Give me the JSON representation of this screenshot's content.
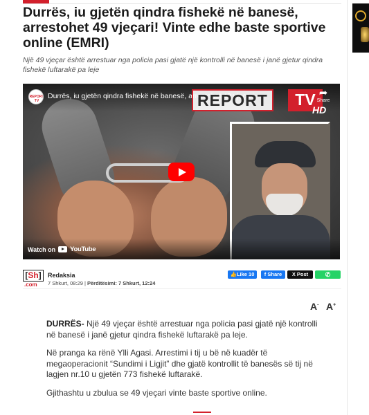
{
  "article": {
    "title": "Durrës, iu gjetën qindra fishekë në banesë, arrestohet 49 vjeçari! Vinte edhe baste sportive online (EMRI)",
    "lead": "Një 49 vjeçar është arrestuar nga policia pasi gjatë një kontrolli në banesë i janë gjetur qindra fishekë luftarakë pa leje",
    "location": "DURRËS-",
    "paragraph1_rest": " Një 49 vjeçar është arrestuar nga policia pasi gjatë një kontrolli në banesë i janë gjetur qindra fishekë luftarakë pa leje.",
    "paragraph2": "Në pranga ka rënë Ylli Agasi. Arrestimi i tij u bë në kuadër të megaoperacionit “Sundimi i Ligjit” dhe gjatë kontrollit të banesës së tij në lagjen nr.10 u gjetën 773 fishekë luftarakë.",
    "paragraph3": "Gjithashtu u zbulua se 49 vjeçari vinte baste sportive online."
  },
  "video": {
    "title": "Durrës, iu gjetën qindra fishekë në banesë, arrestohet 49 vjeçari",
    "channel_icon_text": "REPORT TV",
    "share_label": "Share",
    "logo_report": "REPORT",
    "logo_tv": "TV",
    "logo_hd": "HD",
    "watch_on": "Watch on",
    "youtube": "YouTube"
  },
  "meta": {
    "logo_sh": "Sh",
    "logo_com": ".com",
    "author": "Redaksia",
    "published": "7 Shkurt, 08:29 | ",
    "updated_label": "Përditësimi:",
    "updated": " 7 Shkurt, 12:24"
  },
  "share": {
    "fb_like": "Like 10",
    "fb_share": "Share",
    "x_post": "Post",
    "whatsapp": "✆"
  },
  "font_controls": {
    "decrease": "A",
    "decrease_sup": "-",
    "increase": "A",
    "increase_sup": "+"
  },
  "colors": {
    "brand_red": "#d3202c",
    "facebook": "#1877f2",
    "whatsapp": "#25d366",
    "youtube_red": "#ff0000"
  }
}
